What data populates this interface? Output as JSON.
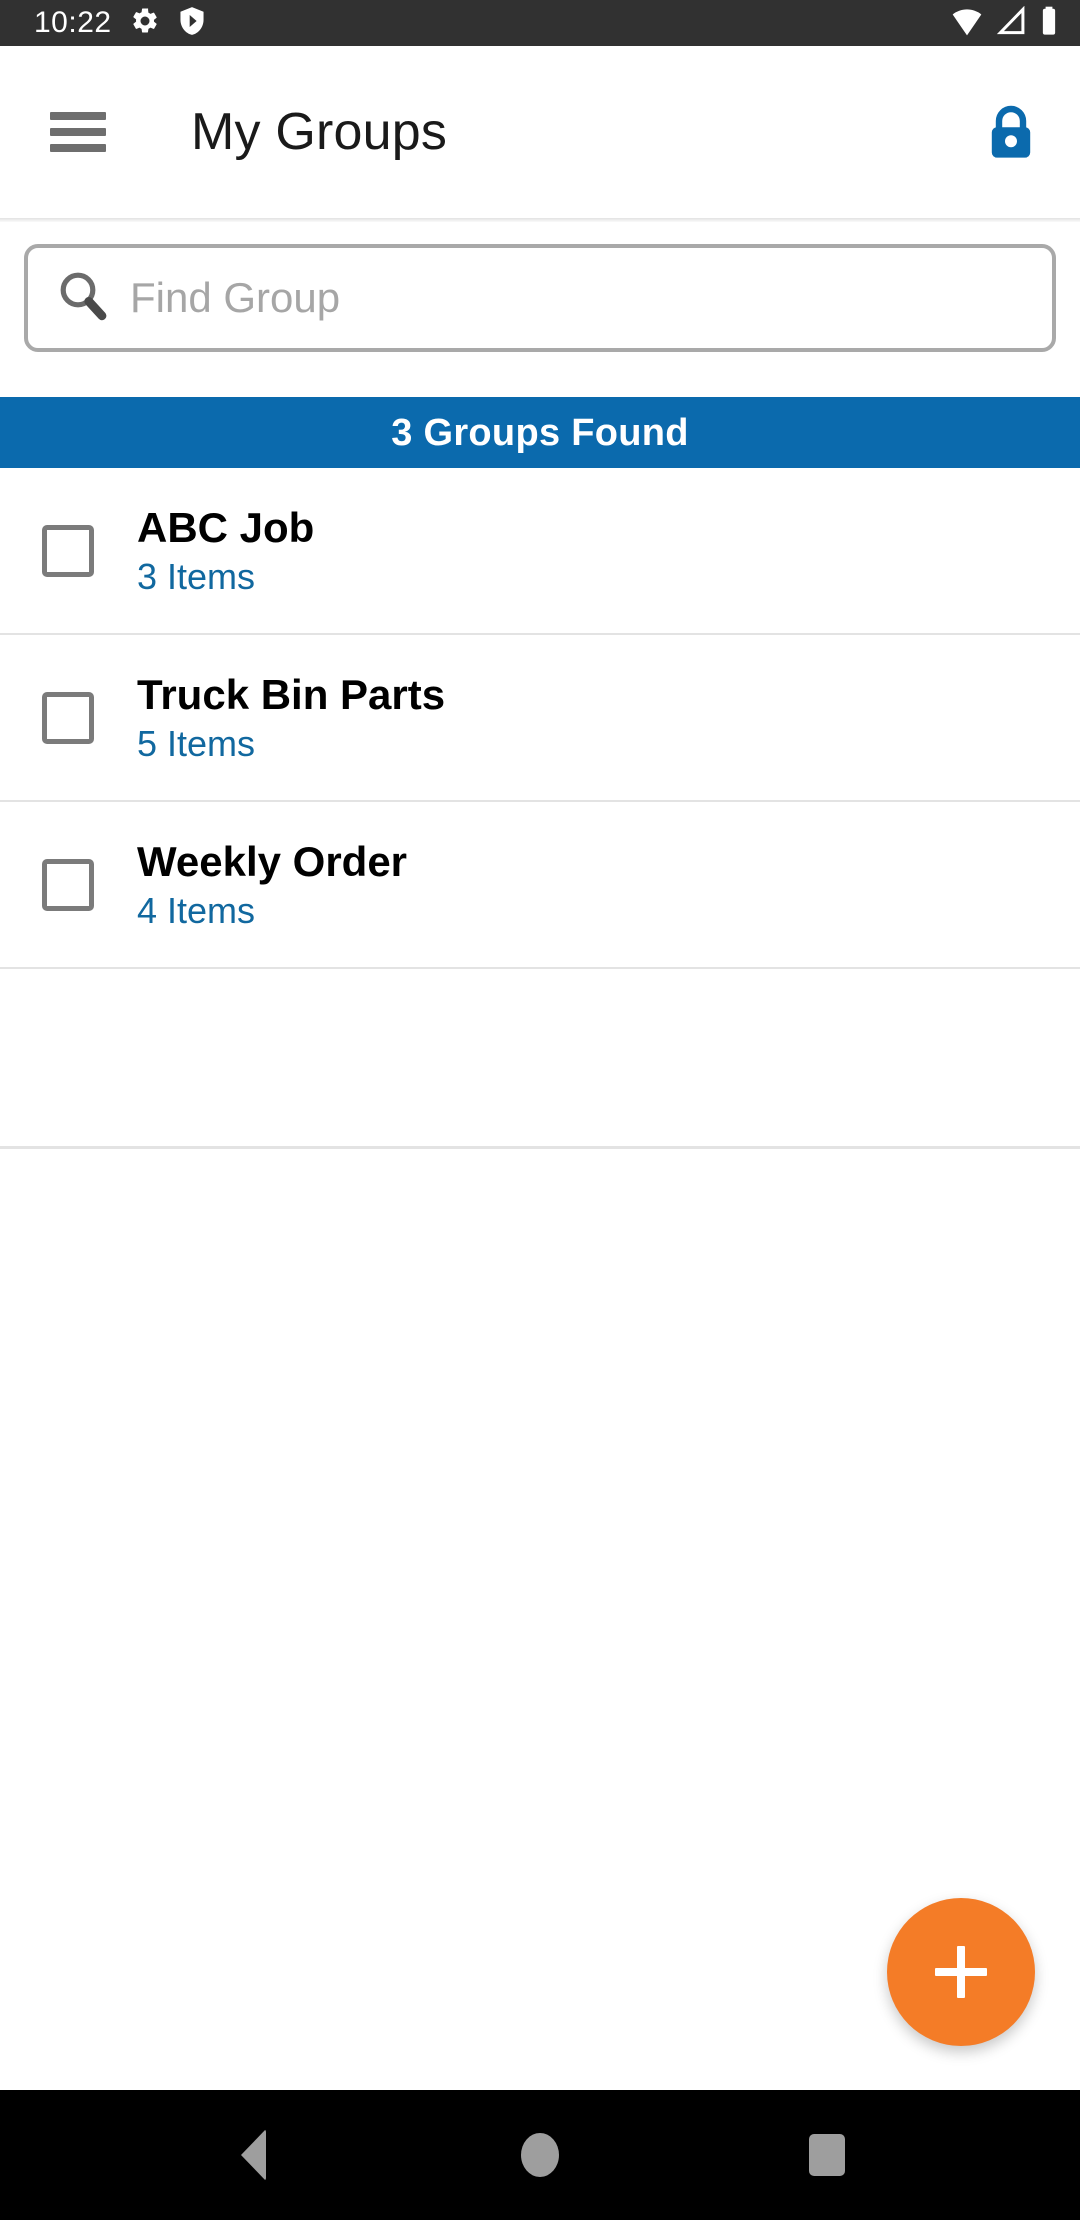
{
  "status_bar": {
    "time": "10:22",
    "left_icons": [
      "gear-icon",
      "shield-play-icon"
    ],
    "right_icons": [
      "wifi-icon",
      "cellular-signal-icon",
      "battery-icon"
    ],
    "background_color": "#313131"
  },
  "app_bar": {
    "menu_icon": "hamburger-menu-icon",
    "title": "My Groups",
    "action_icon": "lock-icon",
    "action_icon_color": "#0b6aad"
  },
  "search": {
    "icon": "search-icon",
    "value": "",
    "placeholder": "Find Group"
  },
  "banner": {
    "text": "3 Groups Found",
    "background_color": "#0b6aad",
    "text_color": "#ffffff"
  },
  "groups": {
    "count": 3,
    "items": [
      {
        "name": "ABC Job",
        "items_label": "3 Items",
        "checked": false
      },
      {
        "name": "Truck Bin Parts",
        "items_label": "5 Items",
        "checked": false
      },
      {
        "name": "Weekly Order",
        "items_label": "4 Items",
        "checked": false
      }
    ],
    "item_count_color": "#11689f"
  },
  "fab": {
    "icon": "plus-icon",
    "label": "+",
    "background_color": "#f47c27"
  },
  "nav_bar": {
    "back_icon": "back-triangle-icon",
    "home_icon": "home-circle-icon",
    "recents_icon": "recents-square-icon",
    "background_color": "#000000"
  }
}
